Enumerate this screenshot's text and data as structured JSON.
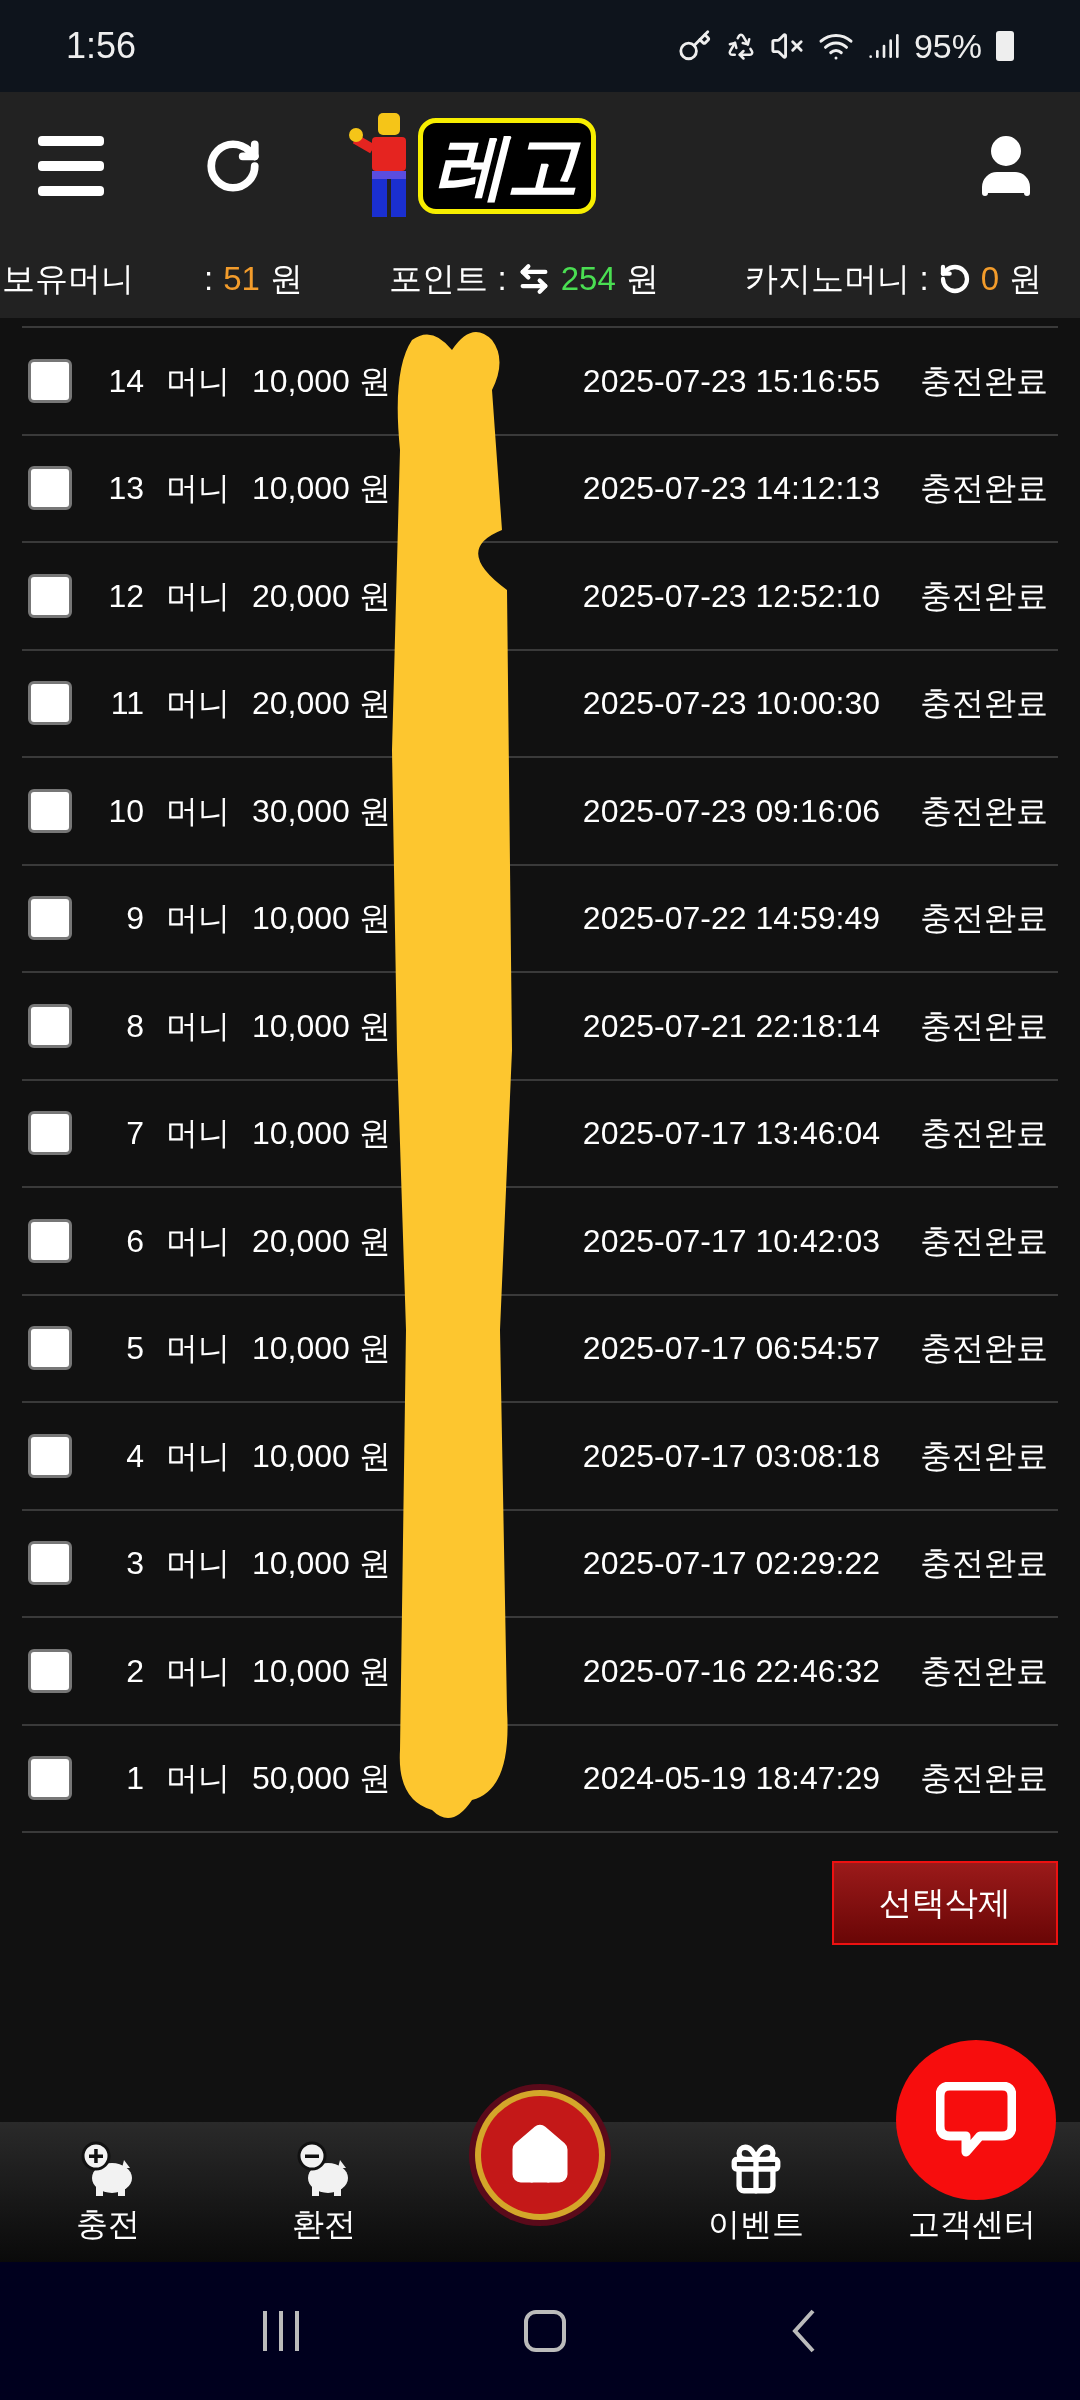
{
  "status_bar": {
    "time": "1:56",
    "battery": "95%"
  },
  "header": {
    "logo_text": "레고"
  },
  "balances": [
    {
      "kind": "money",
      "label": "보유머니",
      "separator": ":",
      "value": "51",
      "unit": "원",
      "color": "#f39c2b"
    },
    {
      "kind": "points",
      "label": "포인트 :",
      "value": "254",
      "unit": "원",
      "color": "#4ade52"
    },
    {
      "kind": "casino",
      "label": "카지노머니 :",
      "value": "0",
      "unit": "원",
      "color": "#f39c2b"
    }
  ],
  "rows": [
    {
      "no": "14",
      "type": "머니",
      "amount": "10,000 원",
      "date": "2025-07-23 15:16:55",
      "status": "충전완료",
      "checked": false
    },
    {
      "no": "13",
      "type": "머니",
      "amount": "10,000 원",
      "date": "2025-07-23 14:12:13",
      "status": "충전완료",
      "checked": false
    },
    {
      "no": "12",
      "type": "머니",
      "amount": "20,000 원",
      "date": "2025-07-23 12:52:10",
      "status": "충전완료",
      "checked": false
    },
    {
      "no": "11",
      "type": "머니",
      "amount": "20,000 원",
      "date": "2025-07-23 10:00:30",
      "status": "충전완료",
      "checked": false
    },
    {
      "no": "10",
      "type": "머니",
      "amount": "30,000 원",
      "date": "2025-07-23 09:16:06",
      "status": "충전완료",
      "checked": false
    },
    {
      "no": "9",
      "type": "머니",
      "amount": "10,000 원",
      "date": "2025-07-22 14:59:49",
      "status": "충전완료",
      "checked": false
    },
    {
      "no": "8",
      "type": "머니",
      "amount": "10,000 원",
      "date": "2025-07-21 22:18:14",
      "status": "충전완료",
      "checked": false
    },
    {
      "no": "7",
      "type": "머니",
      "amount": "10,000 원",
      "date": "2025-07-17 13:46:04",
      "status": "충전완료",
      "checked": false
    },
    {
      "no": "6",
      "type": "머니",
      "amount": "20,000 원",
      "date": "2025-07-17 10:42:03",
      "status": "충전완료",
      "checked": false
    },
    {
      "no": "5",
      "type": "머니",
      "amount": "10,000 원",
      "date": "2025-07-17 06:54:57",
      "status": "충전완료",
      "checked": false
    },
    {
      "no": "4",
      "type": "머니",
      "amount": "10,000 원",
      "date": "2025-07-17 03:08:18",
      "status": "충전완료",
      "checked": false
    },
    {
      "no": "3",
      "type": "머니",
      "amount": "10,000 원",
      "date": "2025-07-17 02:29:22",
      "status": "충전완료",
      "checked": false
    },
    {
      "no": "2",
      "type": "머니",
      "amount": "10,000 원",
      "date": "2025-07-16 22:46:32",
      "status": "충전완료",
      "checked": false
    },
    {
      "no": "1",
      "type": "머니",
      "amount": "50,000 원",
      "date": "2024-05-19 18:47:29",
      "status": "충전완료",
      "checked": false
    }
  ],
  "delete_button": "선택삭제",
  "bottom_nav": [
    {
      "kind": "deposit",
      "label": "충전"
    },
    {
      "kind": "withdraw",
      "label": "환전"
    },
    {
      "kind": "home"
    },
    {
      "kind": "event",
      "label": "이벤트"
    },
    {
      "kind": "support",
      "label": "고객센터"
    }
  ]
}
